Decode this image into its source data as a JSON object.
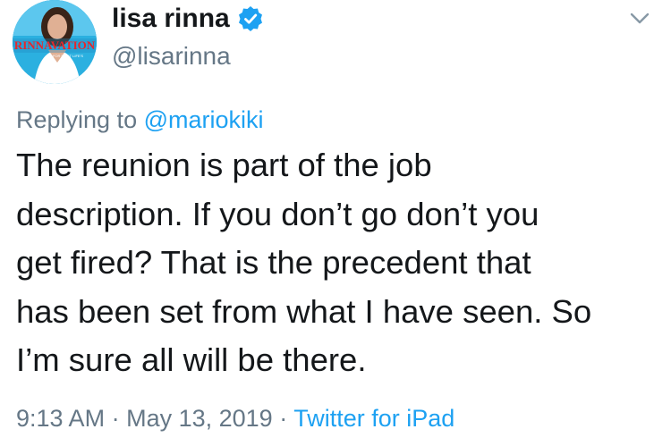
{
  "user": {
    "name": "lisa rinna",
    "handle": "@lisarinna",
    "verified": true,
    "avatar_banner_text": "RINNAVATION",
    "avatar_tagline": "FOR MOST LIFE'S"
  },
  "reply": {
    "prefix": "Replying to",
    "mention": "@mariokiki"
  },
  "tweet": {
    "lines": [
      "The reunion is part of the job",
      "description. If you don’t go don’t you",
      "get fired? That is the precedent that",
      "has been set from what I have seen. So",
      "I’m sure all will be there."
    ]
  },
  "meta": {
    "time": "9:13 AM",
    "separator": "·",
    "date": "May 13, 2019",
    "source": "Twitter for iPad"
  },
  "icons": {
    "verified": "verified-badge-icon",
    "more": "chevron-down-icon"
  },
  "colors": {
    "link": "#1da1f2",
    "secondary_text": "#657786",
    "primary_text": "#14171a",
    "verified": "#1da1f2"
  }
}
